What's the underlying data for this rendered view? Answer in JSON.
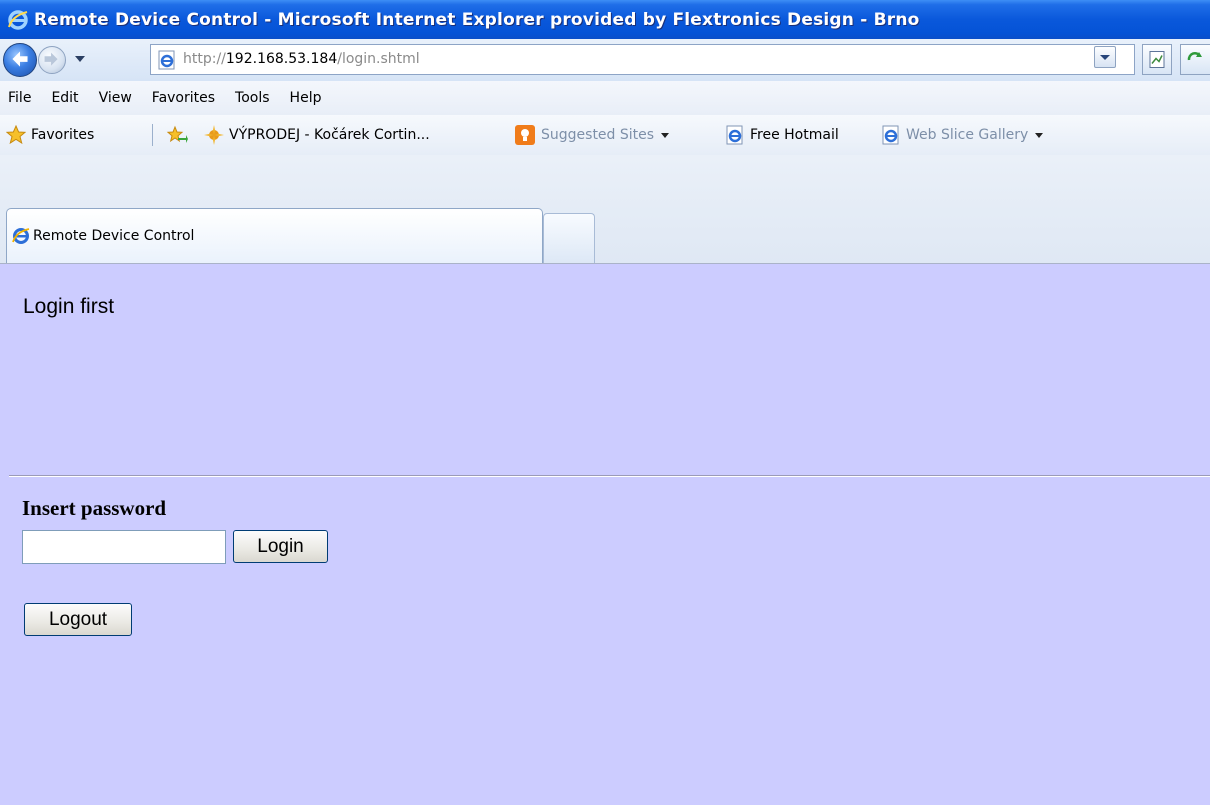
{
  "window": {
    "title": "Remote Device Control - Microsoft Internet Explorer provided by Flextronics Design - Brno"
  },
  "address_bar": {
    "url_prefix": "http://",
    "url_host": "192.168.53.184",
    "url_path": "/login.shtml"
  },
  "menu": {
    "items": [
      "File",
      "Edit",
      "View",
      "Favorites",
      "Tools",
      "Help"
    ]
  },
  "favorites_bar": {
    "favorites_label": "Favorites",
    "items": [
      {
        "label": "VÝPRODEJ - Kočárek Cortin...",
        "icon": "star-burst-icon"
      },
      {
        "label": "Suggested Sites",
        "icon": "suggested-sites-icon",
        "has_dropdown": true
      },
      {
        "label": "Free Hotmail",
        "icon": "ie-page-icon"
      },
      {
        "label": "Web Slice Gallery",
        "icon": "ie-page-icon",
        "has_dropdown": true
      }
    ]
  },
  "tabs": [
    {
      "label": "Remote Device Control",
      "active": true
    }
  ],
  "page": {
    "heading": "Login first",
    "password_label": "Insert password",
    "password_value": "",
    "login_button": "Login",
    "logout_button": "Logout",
    "background": "#ccccff"
  }
}
